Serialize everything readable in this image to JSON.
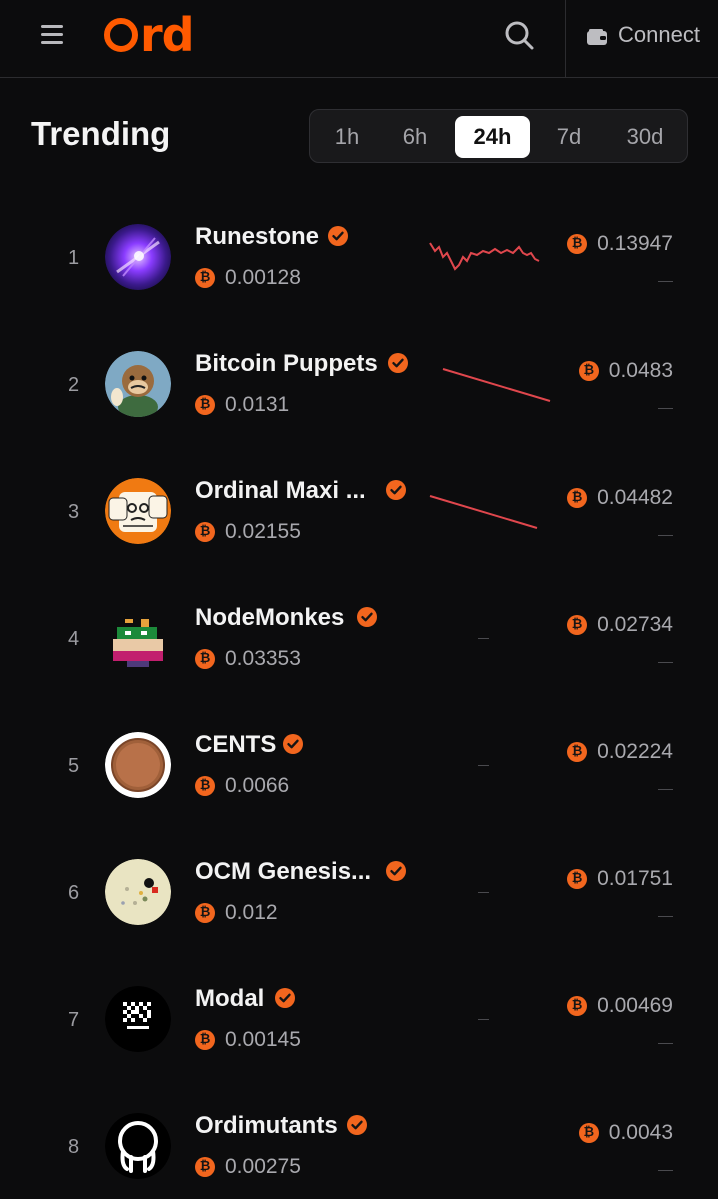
{
  "header": {
    "logo_text": "rd",
    "connect_label": "Connect"
  },
  "trending": {
    "title": "Trending",
    "ranges": [
      "1h",
      "6h",
      "24h",
      "7d",
      "30d"
    ],
    "active_range": "24h"
  },
  "collections": [
    {
      "rank": "1",
      "name": "Runestone",
      "floor": "0.00128",
      "volume": "0.13947",
      "change": "—",
      "spark": "line"
    },
    {
      "rank": "2",
      "name": "Bitcoin Puppets",
      "floor": "0.0131",
      "volume": "0.0483",
      "change": "—",
      "spark": "down"
    },
    {
      "rank": "3",
      "name": "Ordinal Maxi ...",
      "floor": "0.02155",
      "volume": "0.04482",
      "change": "—",
      "spark": "down"
    },
    {
      "rank": "4",
      "name": "NodeMonkes",
      "floor": "0.03353",
      "volume": "0.02734",
      "change": "—",
      "spark": "none"
    },
    {
      "rank": "5",
      "name": "CENTS",
      "floor": "0.0066",
      "volume": "0.02224",
      "change": "—",
      "spark": "none"
    },
    {
      "rank": "6",
      "name": "OCM Genesis...",
      "floor": "0.012",
      "volume": "0.01751",
      "change": "—",
      "spark": "none"
    },
    {
      "rank": "7",
      "name": "Modal",
      "floor": "0.00145",
      "volume": "0.00469",
      "change": "—",
      "spark": "none"
    },
    {
      "rank": "8",
      "name": "Ordimutants",
      "floor": "0.00275",
      "volume": "0.0043",
      "change": "—",
      "spark": "none"
    }
  ],
  "icons": {
    "btc": "₿",
    "menu": "menu-icon",
    "search": "search-icon",
    "wallet": "wallet-icon",
    "verified": "verified-icon"
  },
  "colors": {
    "accent": "#ff5a00",
    "btc": "#f2661e",
    "spark_down": "#e0474d",
    "background": "#0c0c0d"
  }
}
